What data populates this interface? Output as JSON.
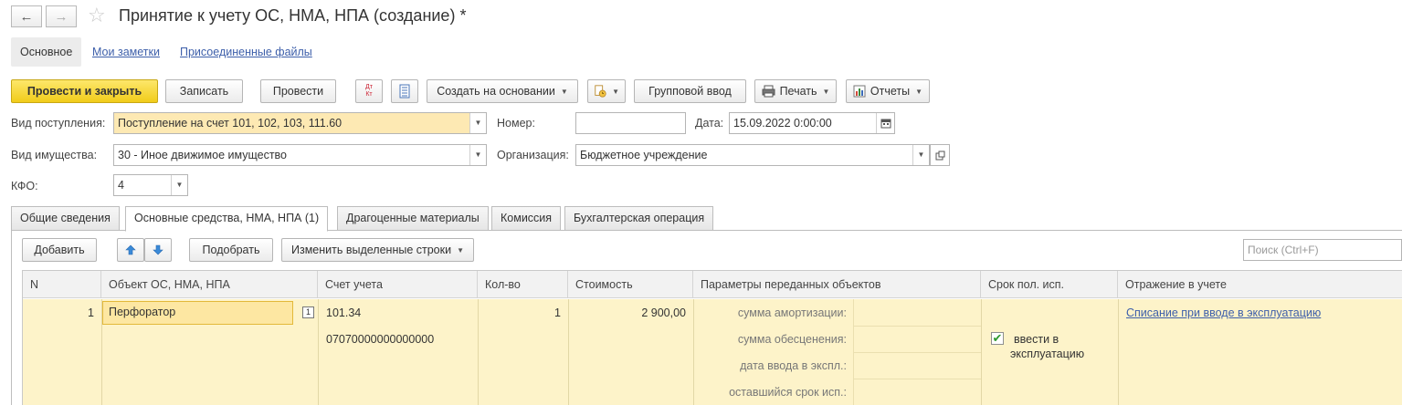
{
  "window": {
    "title": "Принятие к учету ОС, НМА, НПА (создание) *",
    "back_icon": "←",
    "forward_icon": "→",
    "star_icon": "☆"
  },
  "top_tabs": [
    {
      "label": "Основное"
    },
    {
      "label": "Мои заметки"
    },
    {
      "label": "Присоединенные файлы"
    }
  ],
  "toolbar": {
    "post_close": "Провести и закрыть",
    "save": "Записать",
    "post": "Провести",
    "dt_kt_icon": "Дт Кт",
    "create_based": "Создать на основании",
    "group_input": "Групповой ввод",
    "print": "Печать",
    "reports": "Отчеты"
  },
  "form": {
    "receipt_type_label": "Вид поступления:",
    "receipt_type_value": "Поступление на счет 101, 102, 103, 111.60",
    "number_label": "Номер:",
    "number_value": "",
    "date_label": "Дата:",
    "date_value": "15.09.2022  0:00:00",
    "property_type_label": "Вид имущества:",
    "property_type_value": "30 - Иное движимое имущество",
    "org_label": "Организация:",
    "org_value": "Бюджетное учреждение",
    "kfo_label": "КФО:",
    "kfo_value": "4"
  },
  "form_tabs": [
    {
      "label": "Общие сведения"
    },
    {
      "label": "Основные средства, НМА, НПА (1)"
    },
    {
      "label": "Драгоценные материалы"
    },
    {
      "label": "Комиссия"
    },
    {
      "label": "Бухгалтерская операция"
    }
  ],
  "table_toolbar": {
    "add": "Добавить",
    "pick": "Подобрать",
    "change_selected": "Изменить выделенные строки",
    "search_placeholder": "Поиск (Ctrl+F)"
  },
  "table": {
    "columns": [
      "N",
      "Объект ОС, НМА, НПА",
      "Счет учета",
      "Кол-во",
      "Стоимость",
      "Параметры переданных объектов",
      "Срок пол. исп.",
      "Отражение в учете"
    ],
    "row": {
      "n": "1",
      "object": "Перфоратор",
      "account": "101.34",
      "account_code": "07070000000000000",
      "qty": "1",
      "cost": "2 900,00",
      "param_labels": [
        "сумма амортизации:",
        "сумма обесценения:",
        "дата ввода в экспл.:",
        "оставшийся срок исп.:"
      ],
      "checkbox_label_1": "ввести в",
      "checkbox_label_2": "эксплуатацию",
      "checkbox_checked": true,
      "reflection": "Списание при вводе в эксплуатацию"
    }
  }
}
